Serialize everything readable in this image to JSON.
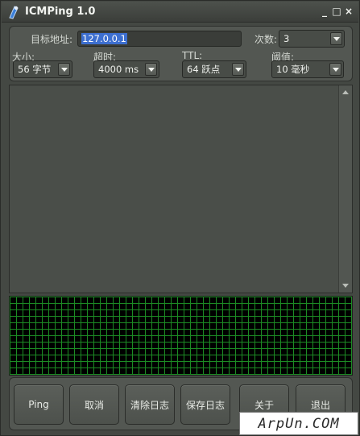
{
  "window": {
    "title": "ICMPing 1.0",
    "controls": {
      "minimize": "_",
      "maximize": "□",
      "close": "×"
    }
  },
  "settings": {
    "target": {
      "label": "目标地址:",
      "value": "127.0.0.1"
    },
    "count": {
      "label": "次数:",
      "value": "3"
    },
    "size": {
      "label": "大小:",
      "value": "56 字节"
    },
    "timeout": {
      "label": "超时:",
      "value": "4000 ms"
    },
    "ttl": {
      "label": "TTL:",
      "value": "64 跃点"
    },
    "threshold": {
      "label": "阈值:",
      "value": "10 毫秒"
    }
  },
  "log": {
    "content": ""
  },
  "buttons": {
    "ping": "Ping",
    "cancel": "取消",
    "clear_log": "清除日志",
    "save_log": "保存日志",
    "about": "关于",
    "exit": "退出"
  },
  "watermark": "ArpUn.COM",
  "colors": {
    "background": "#444843",
    "grid_line": "#1c8b24",
    "graph_bg": "#000000",
    "selection": "#3d6fd0"
  }
}
